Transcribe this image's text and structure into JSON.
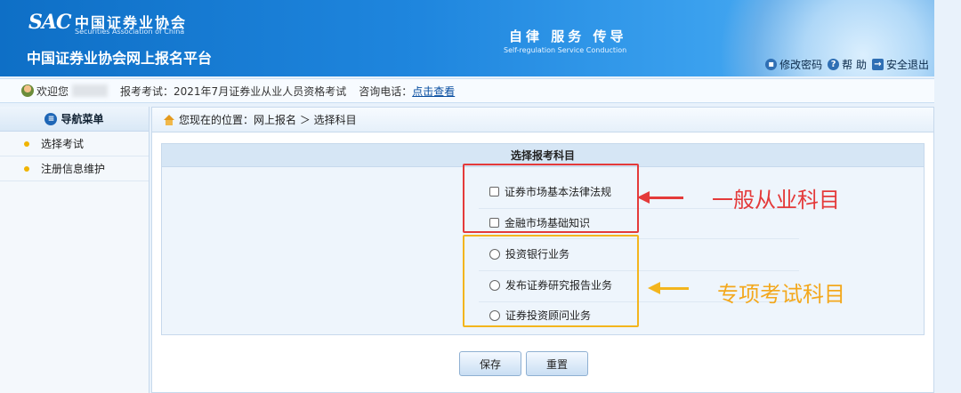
{
  "header": {
    "logo_mark": "SAC",
    "logo_cn": "中国证券业协会",
    "logo_en": "Securities Association of China",
    "site_title": "中国证券业协会网上报名平台",
    "slogan_cn": "自律  服务  传导",
    "slogan_en": "Self-regulation  Service  Conduction",
    "links": {
      "change_password": "修改密码",
      "help": "帮 助",
      "logout": "安全退出"
    }
  },
  "infobar": {
    "welcome": "欢迎您",
    "exam": "报考考试：2021年7月证券业从业人员资格考试",
    "phone_label": "咨询电话：",
    "phone_link": "点击查看"
  },
  "sidebar": {
    "title": "导航菜单",
    "items": [
      {
        "label": "选择考试"
      },
      {
        "label": "注册信息维护"
      }
    ]
  },
  "breadcrumb": {
    "text": "您现在的位置：网上报名 ＞ 选择科目"
  },
  "panel": {
    "title": "选择报考科目",
    "general_subjects": [
      {
        "label": "证券市场基本法律法规",
        "checked": false
      },
      {
        "label": "金融市场基础知识",
        "checked": false
      }
    ],
    "special_subjects": [
      {
        "label": "投资银行业务",
        "selected": false
      },
      {
        "label": "发布证券研究报告业务",
        "selected": false
      },
      {
        "label": "证券投资顾问业务",
        "selected": false
      }
    ]
  },
  "annotations": {
    "general": "一般从业科目",
    "special": "专项考试科目",
    "general_color": "#e43a3a",
    "special_color": "#f3b51d"
  },
  "buttons": {
    "save": "保存",
    "reset": "重置"
  }
}
